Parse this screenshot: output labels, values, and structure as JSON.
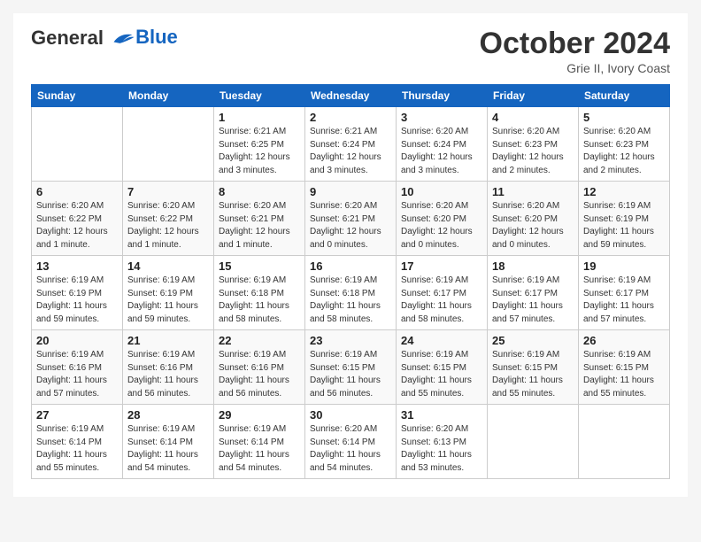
{
  "logo": {
    "line1": "General",
    "line2": "Blue"
  },
  "title": "October 2024",
  "subtitle": "Grie II, Ivory Coast",
  "headers": [
    "Sunday",
    "Monday",
    "Tuesday",
    "Wednesday",
    "Thursday",
    "Friday",
    "Saturday"
  ],
  "weeks": [
    [
      {
        "day": "",
        "info": ""
      },
      {
        "day": "",
        "info": ""
      },
      {
        "day": "1",
        "info": "Sunrise: 6:21 AM\nSunset: 6:25 PM\nDaylight: 12 hours and 3 minutes."
      },
      {
        "day": "2",
        "info": "Sunrise: 6:21 AM\nSunset: 6:24 PM\nDaylight: 12 hours and 3 minutes."
      },
      {
        "day": "3",
        "info": "Sunrise: 6:20 AM\nSunset: 6:24 PM\nDaylight: 12 hours and 3 minutes."
      },
      {
        "day": "4",
        "info": "Sunrise: 6:20 AM\nSunset: 6:23 PM\nDaylight: 12 hours and 2 minutes."
      },
      {
        "day": "5",
        "info": "Sunrise: 6:20 AM\nSunset: 6:23 PM\nDaylight: 12 hours and 2 minutes."
      }
    ],
    [
      {
        "day": "6",
        "info": "Sunrise: 6:20 AM\nSunset: 6:22 PM\nDaylight: 12 hours and 1 minute."
      },
      {
        "day": "7",
        "info": "Sunrise: 6:20 AM\nSunset: 6:22 PM\nDaylight: 12 hours and 1 minute."
      },
      {
        "day": "8",
        "info": "Sunrise: 6:20 AM\nSunset: 6:21 PM\nDaylight: 12 hours and 1 minute."
      },
      {
        "day": "9",
        "info": "Sunrise: 6:20 AM\nSunset: 6:21 PM\nDaylight: 12 hours and 0 minutes."
      },
      {
        "day": "10",
        "info": "Sunrise: 6:20 AM\nSunset: 6:20 PM\nDaylight: 12 hours and 0 minutes."
      },
      {
        "day": "11",
        "info": "Sunrise: 6:20 AM\nSunset: 6:20 PM\nDaylight: 12 hours and 0 minutes."
      },
      {
        "day": "12",
        "info": "Sunrise: 6:19 AM\nSunset: 6:19 PM\nDaylight: 11 hours and 59 minutes."
      }
    ],
    [
      {
        "day": "13",
        "info": "Sunrise: 6:19 AM\nSunset: 6:19 PM\nDaylight: 11 hours and 59 minutes."
      },
      {
        "day": "14",
        "info": "Sunrise: 6:19 AM\nSunset: 6:19 PM\nDaylight: 11 hours and 59 minutes."
      },
      {
        "day": "15",
        "info": "Sunrise: 6:19 AM\nSunset: 6:18 PM\nDaylight: 11 hours and 58 minutes."
      },
      {
        "day": "16",
        "info": "Sunrise: 6:19 AM\nSunset: 6:18 PM\nDaylight: 11 hours and 58 minutes."
      },
      {
        "day": "17",
        "info": "Sunrise: 6:19 AM\nSunset: 6:17 PM\nDaylight: 11 hours and 58 minutes."
      },
      {
        "day": "18",
        "info": "Sunrise: 6:19 AM\nSunset: 6:17 PM\nDaylight: 11 hours and 57 minutes."
      },
      {
        "day": "19",
        "info": "Sunrise: 6:19 AM\nSunset: 6:17 PM\nDaylight: 11 hours and 57 minutes."
      }
    ],
    [
      {
        "day": "20",
        "info": "Sunrise: 6:19 AM\nSunset: 6:16 PM\nDaylight: 11 hours and 57 minutes."
      },
      {
        "day": "21",
        "info": "Sunrise: 6:19 AM\nSunset: 6:16 PM\nDaylight: 11 hours and 56 minutes."
      },
      {
        "day": "22",
        "info": "Sunrise: 6:19 AM\nSunset: 6:16 PM\nDaylight: 11 hours and 56 minutes."
      },
      {
        "day": "23",
        "info": "Sunrise: 6:19 AM\nSunset: 6:15 PM\nDaylight: 11 hours and 56 minutes."
      },
      {
        "day": "24",
        "info": "Sunrise: 6:19 AM\nSunset: 6:15 PM\nDaylight: 11 hours and 55 minutes."
      },
      {
        "day": "25",
        "info": "Sunrise: 6:19 AM\nSunset: 6:15 PM\nDaylight: 11 hours and 55 minutes."
      },
      {
        "day": "26",
        "info": "Sunrise: 6:19 AM\nSunset: 6:15 PM\nDaylight: 11 hours and 55 minutes."
      }
    ],
    [
      {
        "day": "27",
        "info": "Sunrise: 6:19 AM\nSunset: 6:14 PM\nDaylight: 11 hours and 55 minutes."
      },
      {
        "day": "28",
        "info": "Sunrise: 6:19 AM\nSunset: 6:14 PM\nDaylight: 11 hours and 54 minutes."
      },
      {
        "day": "29",
        "info": "Sunrise: 6:19 AM\nSunset: 6:14 PM\nDaylight: 11 hours and 54 minutes."
      },
      {
        "day": "30",
        "info": "Sunrise: 6:20 AM\nSunset: 6:14 PM\nDaylight: 11 hours and 54 minutes."
      },
      {
        "day": "31",
        "info": "Sunrise: 6:20 AM\nSunset: 6:13 PM\nDaylight: 11 hours and 53 minutes."
      },
      {
        "day": "",
        "info": ""
      },
      {
        "day": "",
        "info": ""
      }
    ]
  ]
}
